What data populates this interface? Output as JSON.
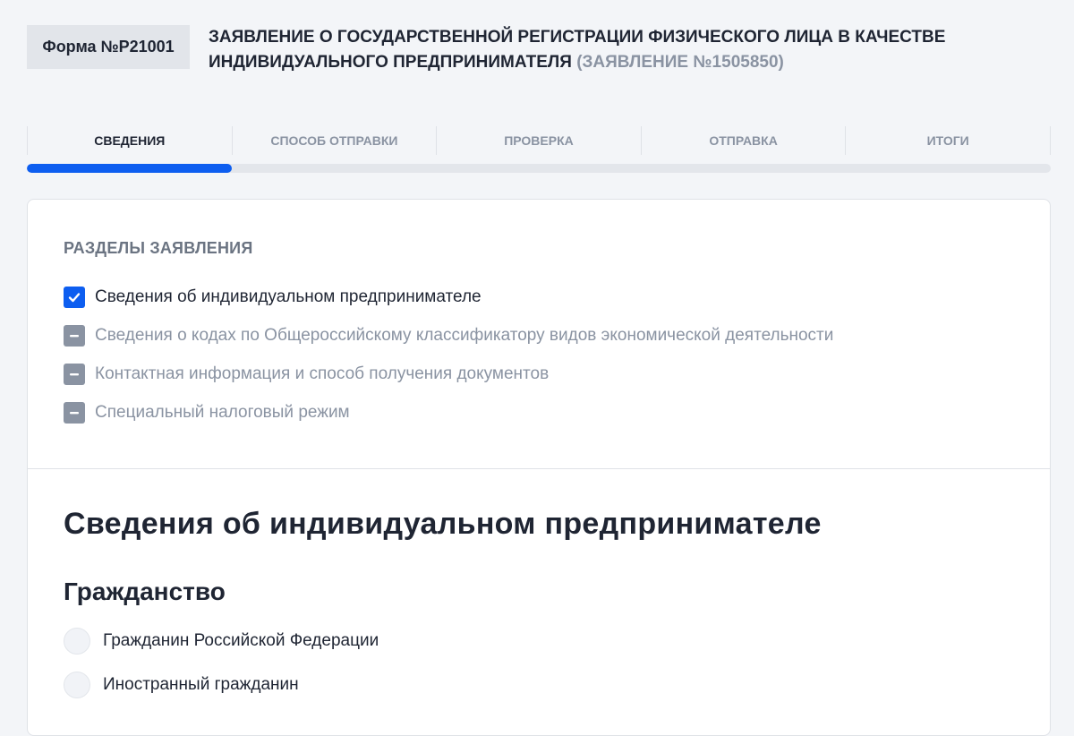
{
  "header": {
    "form_badge": "Форма №Р21001",
    "title": "ЗАЯВЛЕНИЕ О ГОСУДАРСТВЕННОЙ РЕГИСТРАЦИИ ФИЗИЧЕСКОГО ЛИЦА В КАЧЕСТВЕ ИНДИВИДУАЛЬНОГО ПРЕДПРИНИМАТЕЛЯ",
    "application_number": "(ЗАЯВЛЕНИЕ №1505850)"
  },
  "steps": [
    {
      "label": "СВЕДЕНИЯ",
      "active": true
    },
    {
      "label": "СПОСОБ ОТПРАВКИ",
      "active": false
    },
    {
      "label": "ПРОВЕРКА",
      "active": false
    },
    {
      "label": "ОТПРАВКА",
      "active": false
    },
    {
      "label": "ИТОГИ",
      "active": false
    }
  ],
  "progress": {
    "completed_steps": 1,
    "total_steps": 5,
    "fill_color": "#0d5ef0"
  },
  "sections": {
    "title": "РАЗДЕЛЫ ЗАЯВЛЕНИЯ",
    "items": [
      {
        "label": "Сведения об индивидуальном предпринимателе",
        "state": "checked"
      },
      {
        "label": "Сведения о кодах по Общероссийскому классификатору видов экономической деятельности",
        "state": "partial"
      },
      {
        "label": "Контактная информация и способ получения документов",
        "state": "partial"
      },
      {
        "label": "Специальный налоговый режим",
        "state": "partial"
      }
    ]
  },
  "content": {
    "heading": "Сведения об индивидуальном предпринимателе",
    "citizenship": {
      "title": "Гражданство",
      "options": [
        "Гражданин Российской Федерации",
        "Иностранный гражданин"
      ]
    }
  },
  "colors": {
    "accent": "#0d5ef0",
    "muted": "#8a93a2",
    "text": "#1f2533",
    "background": "#f3f5f8"
  }
}
